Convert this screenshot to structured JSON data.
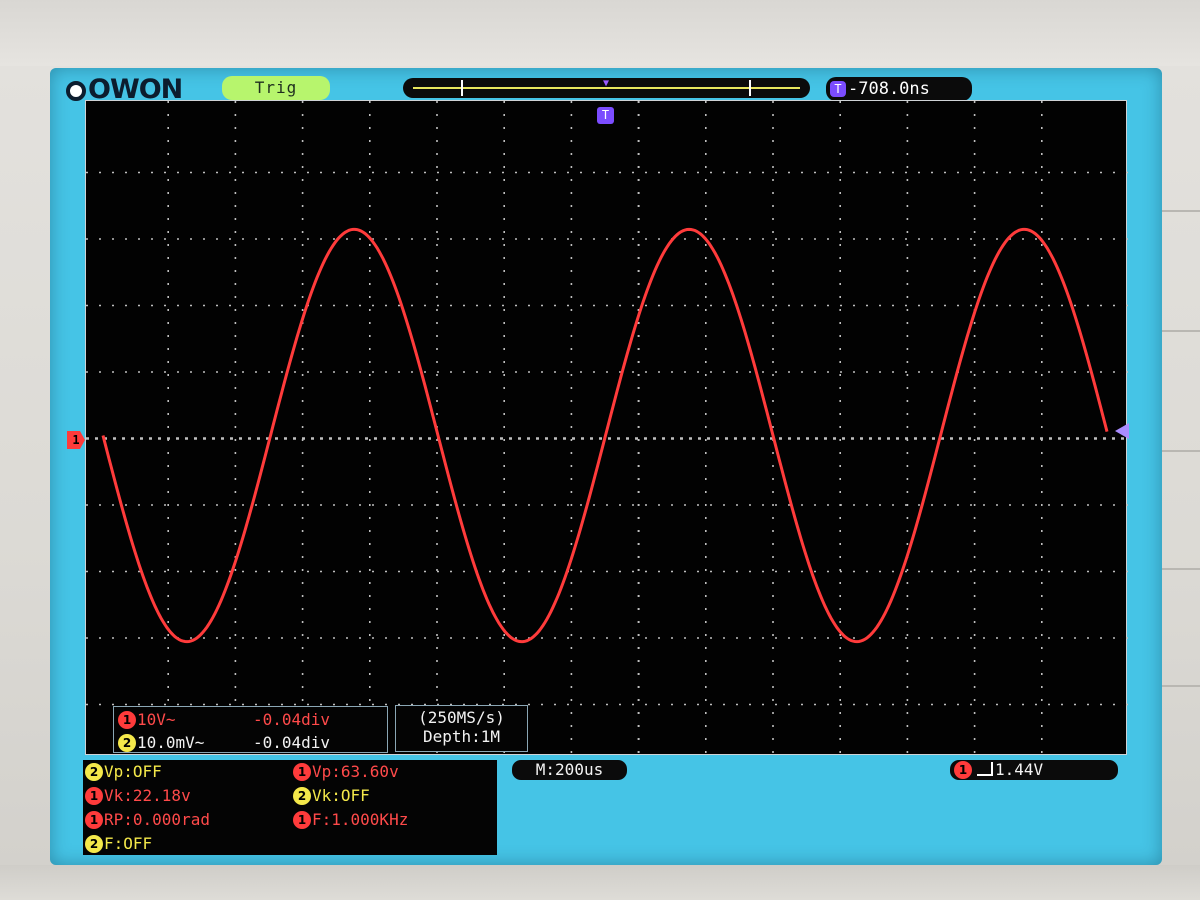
{
  "brand": "OWON",
  "top_bar": {
    "trigger_status": "Trig",
    "trigger_position_icon": "trigger-T-icon",
    "trigger_time": "-708.0ns"
  },
  "channels": {
    "ch1": {
      "number": "1",
      "color": "#ff3b3b",
      "scale": "10V~",
      "offset": "-0.04div"
    },
    "ch2": {
      "number": "2",
      "color": "#f4e84a",
      "scale": "10.0mV~",
      "offset": "-0.04div"
    }
  },
  "acquisition": {
    "sample_rate": "(250MS/s)",
    "depth": "Depth:1M"
  },
  "timebase": "M:200us",
  "trigger": {
    "channel": "1",
    "level": "1.44V",
    "edge_icon": "rising-edge-icon"
  },
  "measurements": [
    {
      "channel": "2",
      "text": "Vp:OFF"
    },
    {
      "channel": "1",
      "text": "Vp:63.60v"
    },
    {
      "channel": "1",
      "text": "Vk:22.18v"
    },
    {
      "channel": "2",
      "text": "Vk:OFF"
    },
    {
      "channel": "1",
      "text": "RP:0.000rad"
    },
    {
      "channel": "1",
      "text": "F:1.000KHz"
    },
    {
      "channel": "2",
      "text": "F:OFF"
    }
  ],
  "chart_data": {
    "type": "line",
    "grid": "on, 15 x 10 divisions, dotted",
    "x_divisions": 15,
    "y_divisions": 10,
    "series": [
      {
        "channel": "1",
        "color": "#ff3b3b",
        "waveform": "sine",
        "amplitude_div": 3.1,
        "cycles_visible": 3,
        "phase_at_left_edge": "zero crossing, falling"
      }
    ]
  }
}
